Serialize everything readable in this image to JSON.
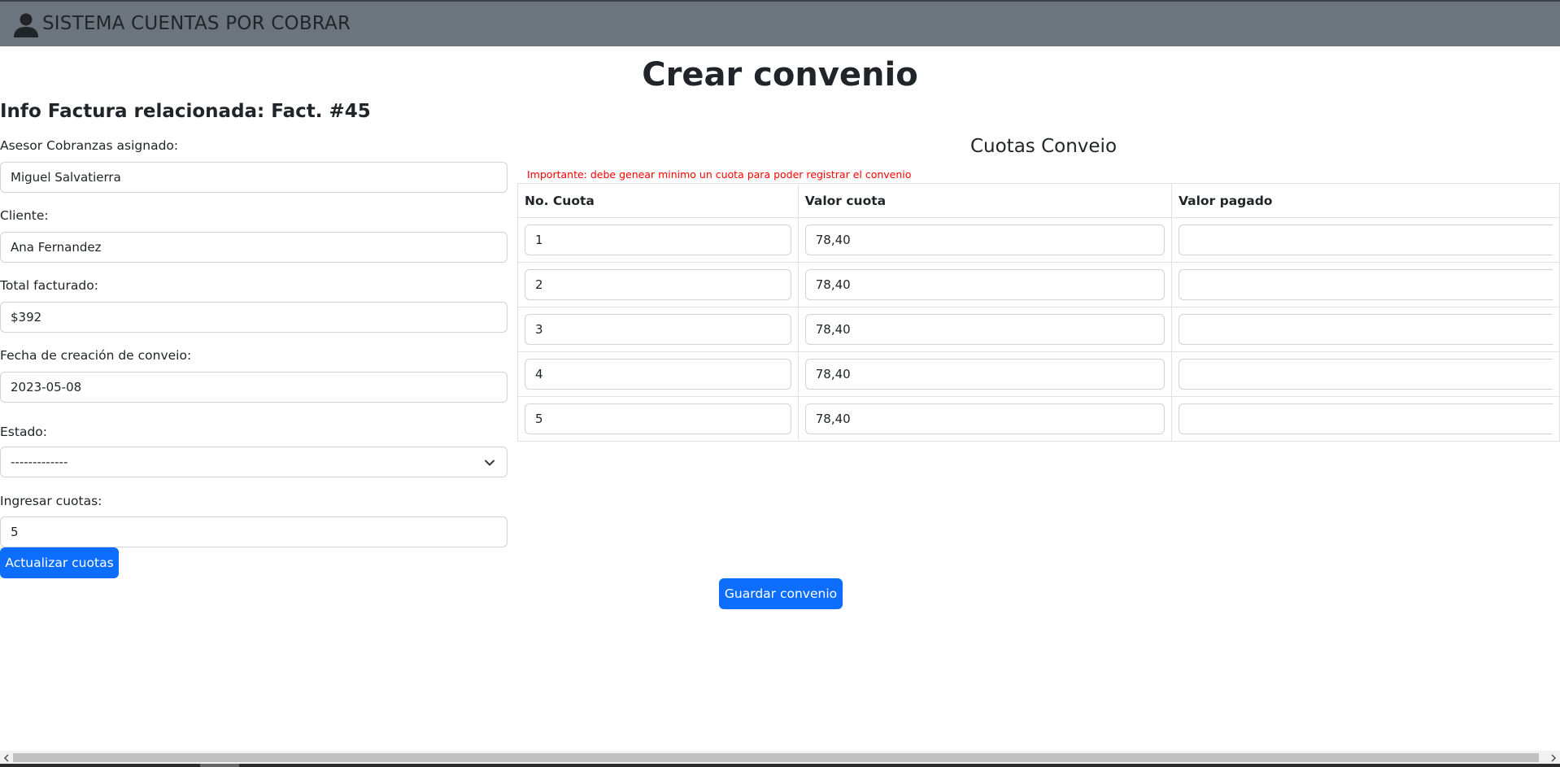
{
  "header": {
    "brand": "SISTEMA CUENTAS POR COBRAR",
    "icon": "user-icon",
    "background": "#6c757d"
  },
  "page": {
    "title": "Crear convenio",
    "invoice_info": "Info Factura relacionada: Fact. #45"
  },
  "form": {
    "asesor_label": "Asesor Cobranzas asignado:",
    "asesor_value": "Miguel Salvatierra",
    "cliente_label": "Cliente:",
    "cliente_value": "Ana Fernandez",
    "total_label": "Total facturado:",
    "total_value": "$392",
    "fecha_label": "Fecha de creación de conveio:",
    "fecha_value": "2023-05-08",
    "estado_label": "Estado:",
    "estado_value": "-------------",
    "cuotas_label": "Ingresar cuotas:",
    "cuotas_value": "5",
    "update_button": "Actualizar cuotas"
  },
  "cuotas": {
    "title": "Cuotas Conveio",
    "notice": "Importante: debe genear minimo un cuota para poder registrar el convenio",
    "notice_color": "#ff0000",
    "headers": [
      "No. Cuota",
      "Valor cuota",
      "Valor pagado"
    ],
    "rows": [
      {
        "numero": "1",
        "valor": "78,40",
        "pagado": ""
      },
      {
        "numero": "2",
        "valor": "78,40",
        "pagado": ""
      },
      {
        "numero": "3",
        "valor": "78,40",
        "pagado": ""
      },
      {
        "numero": "4",
        "valor": "78,40",
        "pagado": ""
      },
      {
        "numero": "5",
        "valor": "78,40",
        "pagado": ""
      }
    ]
  },
  "actions": {
    "save_button": "Guardar convenio",
    "button_color": "#0d6efd"
  }
}
